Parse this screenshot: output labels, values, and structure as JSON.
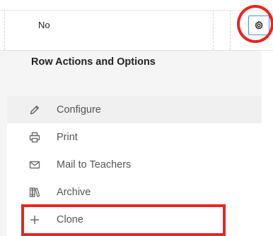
{
  "table_row": {
    "cell_value": "No"
  },
  "dropdown": {
    "title": "Row Actions and Options",
    "items": [
      {
        "label": "Configure",
        "icon": "pencil-icon"
      },
      {
        "label": "Print",
        "icon": "printer-icon"
      },
      {
        "label": "Mail to Teachers",
        "icon": "envelope-icon"
      },
      {
        "label": "Archive",
        "icon": "archive-books-icon"
      },
      {
        "label": "Clone",
        "icon": "plus-icon"
      }
    ]
  },
  "colors": {
    "highlight": "#e8251f",
    "gear_border": "#4a90d9",
    "panel_background": "#f5f5f5",
    "hover_background": "#f0f0f0"
  }
}
